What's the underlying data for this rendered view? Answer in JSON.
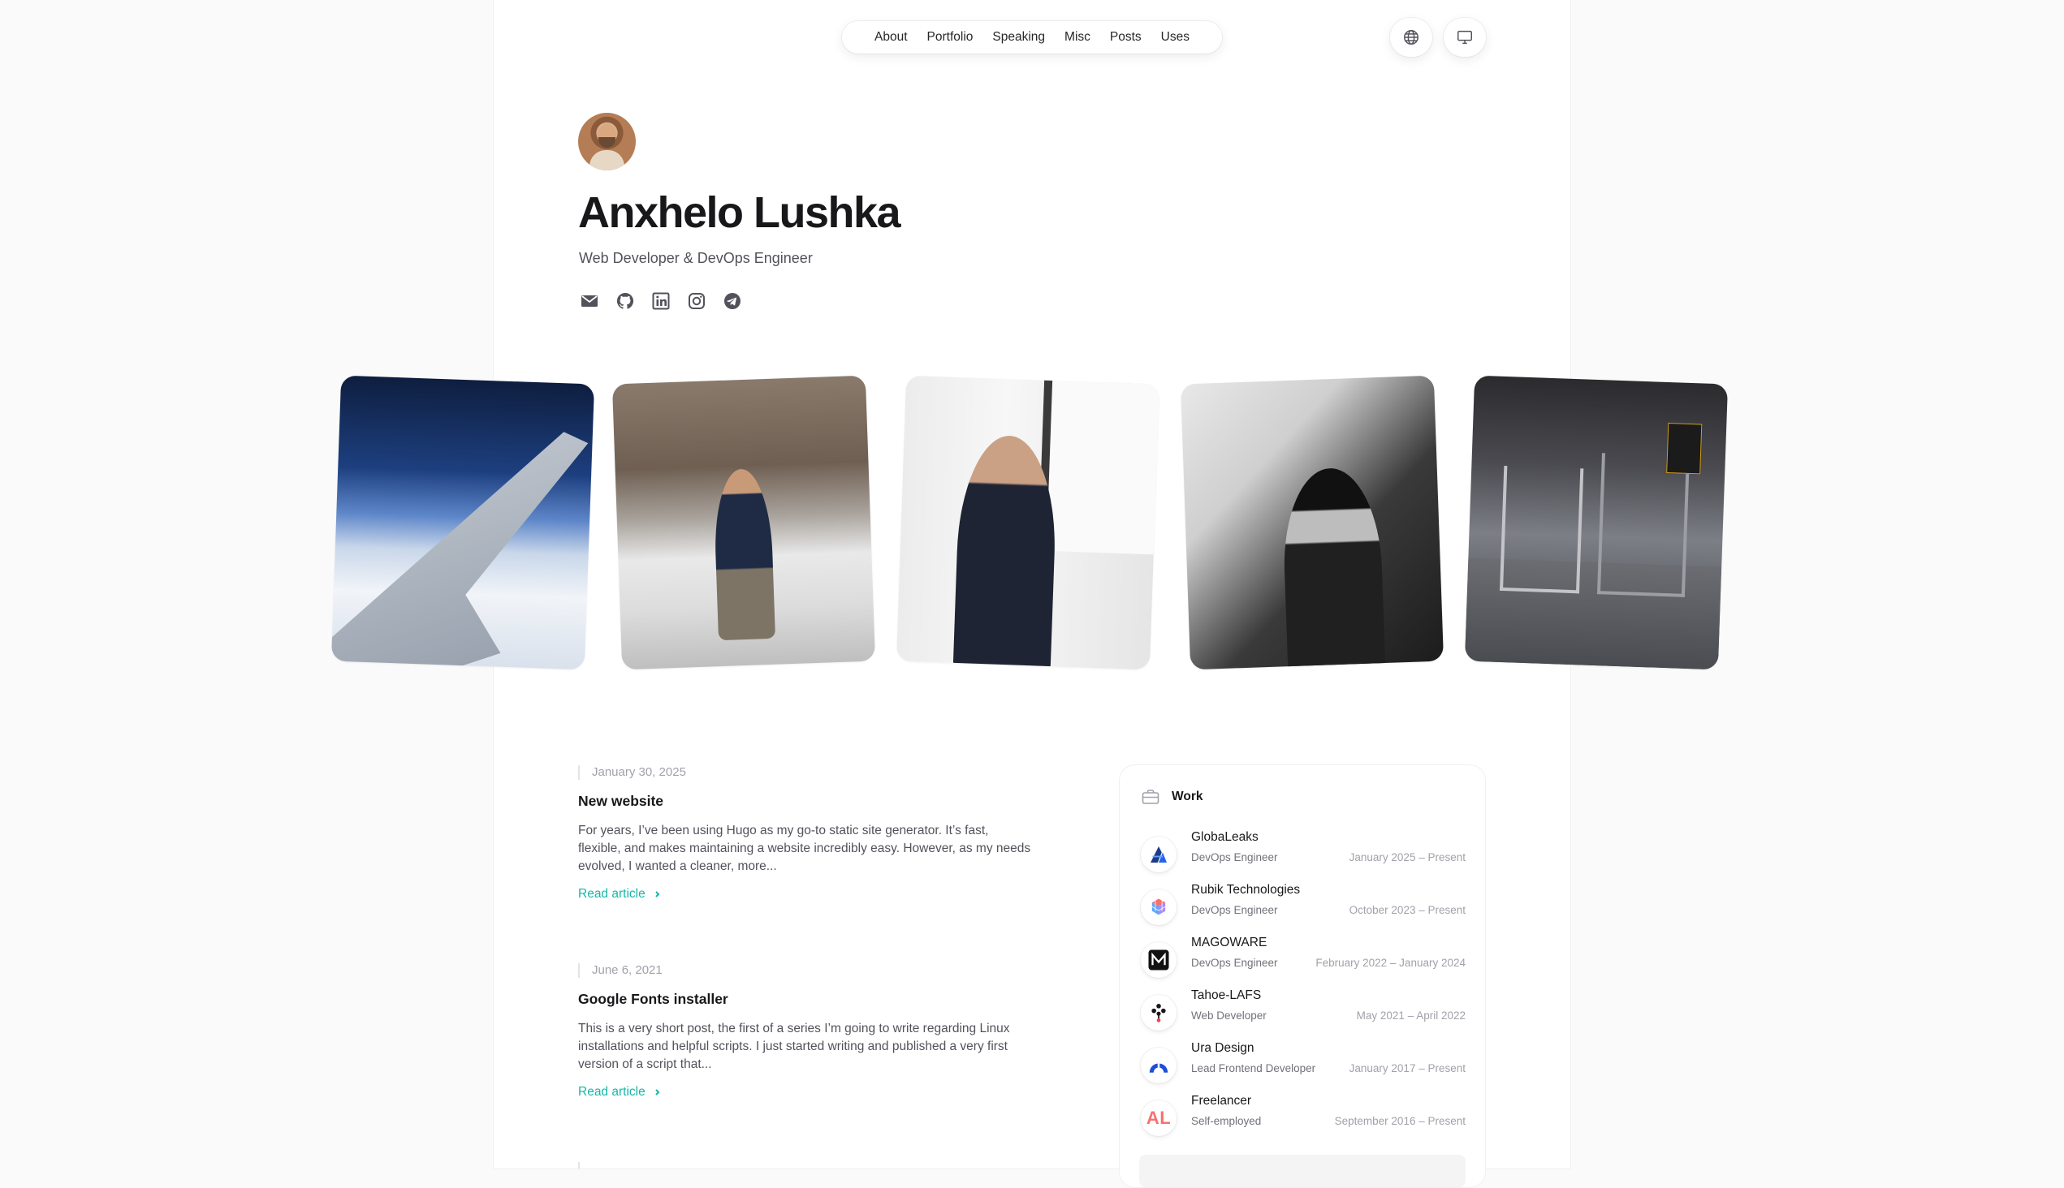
{
  "nav": {
    "items": [
      "About",
      "Portfolio",
      "Speaking",
      "Misc",
      "Posts",
      "Uses"
    ],
    "language_icon": "globe-icon",
    "theme_icon": "monitor-icon"
  },
  "hero": {
    "name": "Anxhelo Lushka",
    "tagline": "Web Developer & DevOps Engineer",
    "socials": [
      "mail-icon",
      "github-icon",
      "linkedin-icon",
      "instagram-icon",
      "telegram-icon"
    ]
  },
  "posts": [
    {
      "date": "January 30, 2025",
      "title": "New website",
      "excerpt": "For years, I’ve been using Hugo as my go-to static site generator. It’s fast, flexible, and makes maintaining a website incredibly easy. However, as my needs evolved, I wanted a cleaner, more...",
      "link": "Read article"
    },
    {
      "date": "June 6, 2021",
      "title": "Google Fonts installer",
      "excerpt": "This is a very short post, the first of a series I’m going to write regarding Linux installations and helpful scripts. I just started writing and published a very first version of a script that...",
      "link": "Read article"
    }
  ],
  "work": {
    "heading": "Work",
    "jobs": [
      {
        "company": "GlobaLeaks",
        "role": "DevOps Engineer",
        "period": "January 2025 – Present"
      },
      {
        "company": "Rubik Technologies",
        "role": "DevOps Engineer",
        "period": "October 2023 – Present"
      },
      {
        "company": "MAGOWARE",
        "role": "DevOps Engineer",
        "period": "February 2022 – January 2024"
      },
      {
        "company": "Tahoe-LAFS",
        "role": "Web Developer",
        "period": "May 2021 – April 2022"
      },
      {
        "company": "Ura Design",
        "role": "Lead Frontend Developer",
        "period": "January 2017 – Present"
      },
      {
        "company": "Freelancer",
        "role": "Self-employed",
        "period": "September 2016 – Present"
      }
    ],
    "freelancer_logo_text": "AL",
    "colors": {
      "accent": "#14b8a6",
      "freelancer": "#ef4444",
      "uradesign": "#1d4ed8"
    }
  }
}
